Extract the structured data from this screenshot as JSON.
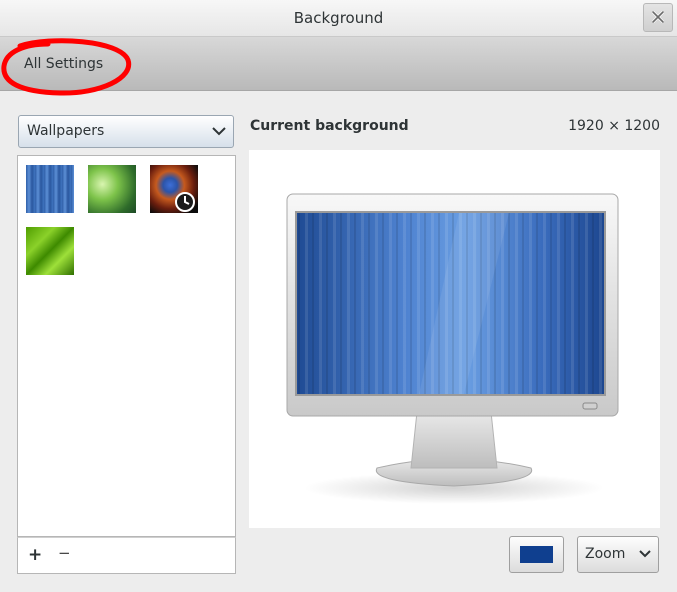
{
  "window": {
    "title": "Background"
  },
  "toolbar": {
    "all_settings_label": "All Settings"
  },
  "wallpaper_source": {
    "selected": "Wallpapers"
  },
  "wallpapers": [
    {
      "id": "blue-stripes"
    },
    {
      "id": "green-bokeh"
    },
    {
      "id": "nebula-slideshow",
      "badge": "clock-icon"
    },
    {
      "id": "green-leaf"
    }
  ],
  "list_footer": {
    "add_label": "+",
    "remove_label": "−"
  },
  "preview": {
    "label": "Current background",
    "resolution": "1920 × 1200"
  },
  "controls": {
    "color": "#0f3f8f",
    "placement_selected": "Zoom"
  },
  "colors": {
    "annotation": "#ff0000",
    "screen_blue": "#2a5aa8"
  }
}
